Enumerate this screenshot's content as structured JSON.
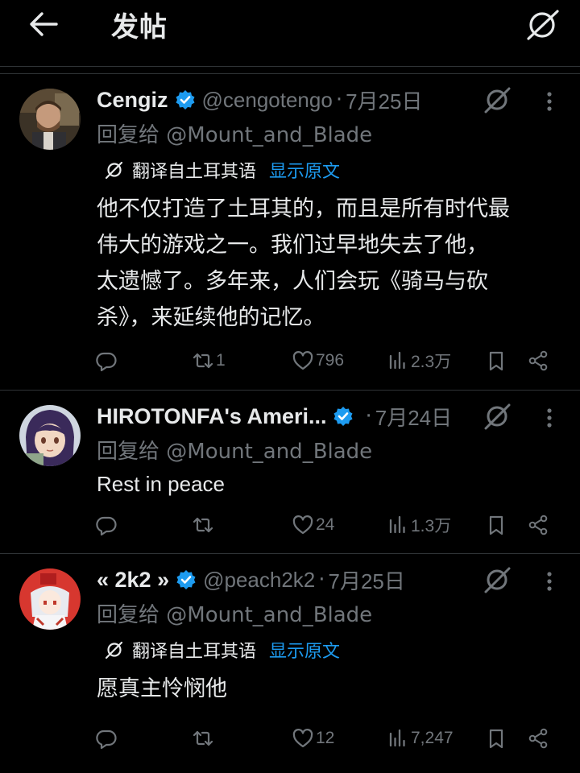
{
  "header": {
    "title": "发帖",
    "back_icon": "arrow-left-icon",
    "grok_icon": "grok-icon"
  },
  "colors": {
    "background": "#000000",
    "text": "#e7e9ea",
    "muted": "#71767b",
    "accent": "#1d9bf0",
    "divider": "#2f3336"
  },
  "tweets": [
    {
      "display_name": "Cengiz",
      "verified": true,
      "handle": "@cengotengo",
      "separator": "·",
      "date": "7月25日",
      "reply_prefix": "回复给",
      "reply_mention": "@Mount_and_Blade",
      "translation": {
        "label": "翻译自土耳其语",
        "show_original": "显示原文"
      },
      "text_lines": [
        "他不仅打造了土耳其的，而且是所有时代最",
        "伟大的游戏之一。我们过早地失去了他，",
        "太遗憾了。多年来，人们会玩《骑马与砍",
        "杀》，来延续他的记忆。"
      ],
      "replies": "",
      "retweets": "1",
      "likes": "796",
      "views": "2.3万"
    },
    {
      "display_name": "HIROTONFA's Ameri...",
      "verified": true,
      "handle": "",
      "separator": "·",
      "date": "7月24日",
      "reply_prefix": "回复给",
      "reply_mention": "@Mount_and_Blade",
      "text_lines": [
        "Rest in peace"
      ],
      "replies": "",
      "retweets": "",
      "likes": "24",
      "views": "1.3万"
    },
    {
      "display_name": "« 2k2 »",
      "verified": true,
      "handle": "@peach2k2",
      "separator": "·",
      "date": "7月25日",
      "reply_prefix": "回复给",
      "reply_mention": "@Mount_and_Blade",
      "translation": {
        "label": "翻译自土耳其语",
        "show_original": "显示原文"
      },
      "text_lines": [
        "愿真主怜悯他"
      ],
      "replies": "",
      "retweets": "",
      "likes": "12",
      "views": "7,247"
    }
  ]
}
